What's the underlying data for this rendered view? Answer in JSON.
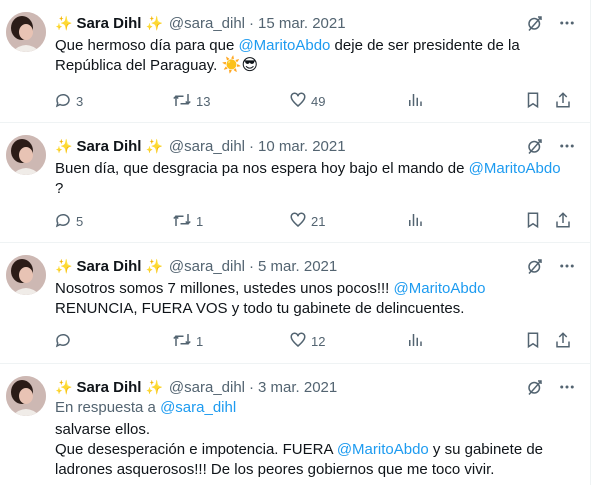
{
  "tweets": [
    {
      "name": "Sara Dihl",
      "handle": "@sara_dihl",
      "date": "15 mar. 2021",
      "text_a": "Que hermoso día para que ",
      "mention": "@MaritoAbdo",
      "text_b": " deje de ser presidente de la República del Paraguay. ",
      "emojis": "☀️😎",
      "replies": "3",
      "retweets": "13",
      "likes": "49"
    },
    {
      "name": "Sara Dihl",
      "handle": "@sara_dihl",
      "date": "10 mar. 2021",
      "text_a": "Buen día, que desgracia pa nos espera hoy bajo el mando de ",
      "mention": "@MaritoAbdo",
      "text_b": "\n?",
      "replies": "5",
      "retweets": "1",
      "likes": "21"
    },
    {
      "name": "Sara Dihl",
      "handle": "@sara_dihl",
      "date": "5 mar. 2021",
      "text_a": "Nosotros somos 7 millones, ustedes unos pocos!!! ",
      "mention": "@MaritoAbdo",
      "text_b": "\nRENUNCIA, FUERA VOS y todo tu gabinete de delincuentes.",
      "replies": "",
      "retweets": "1",
      "likes": "12"
    },
    {
      "name": "Sara Dihl",
      "handle": "@sara_dihl",
      "date": "3 mar. 2021",
      "replying_prefix": "En respuesta a ",
      "replying_handle": "@sara_dihl",
      "text_line1": "salvarse ellos.",
      "text_a": "Que desesperación e impotencia. FUERA ",
      "mention": "@MaritoAbdo",
      "text_b": " y su gabinete de ladrones asquerosos!!! De los peores gobiernos que me toco vivir."
    }
  ],
  "sparkle": "✨",
  "separator": "·",
  "colors": {
    "accent": "#1d9bf0",
    "muted": "#536471",
    "text": "#0f1419",
    "sparkle": "#f5b400"
  },
  "icons": [
    "grok-icon",
    "more-icon",
    "reply-icon",
    "retweet-icon",
    "like-icon",
    "views-icon",
    "bookmark-icon",
    "share-icon"
  ]
}
